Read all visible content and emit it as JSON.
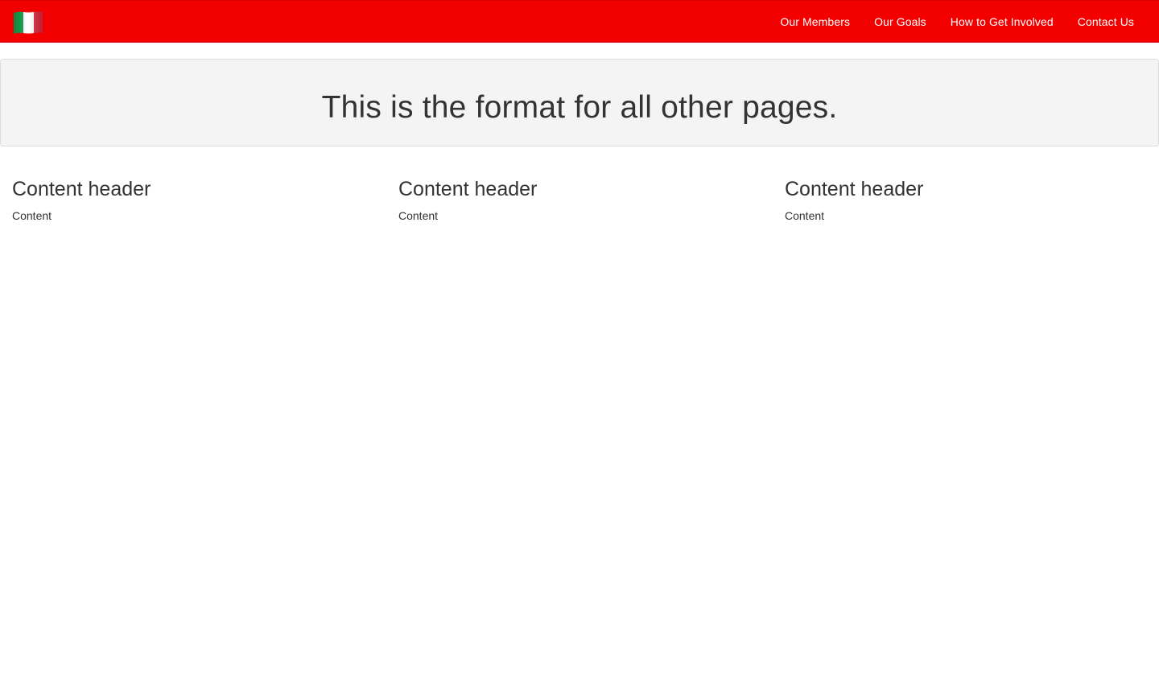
{
  "navbar": {
    "brand_icon": "italian-flag-icon",
    "brand_colors": [
      "#009246",
      "#ffffff",
      "#ce2b37"
    ],
    "background": "#f20000",
    "links": [
      {
        "label": "Our Members"
      },
      {
        "label": "Our Goals"
      },
      {
        "label": "How to Get Involved"
      },
      {
        "label": "Contact Us"
      }
    ]
  },
  "jumbotron": {
    "heading": "This is the format for all other pages."
  },
  "columns": [
    {
      "header": "Content header",
      "body": "Content"
    },
    {
      "header": "Content header",
      "body": "Content"
    },
    {
      "header": "Content header",
      "body": "Content"
    }
  ]
}
